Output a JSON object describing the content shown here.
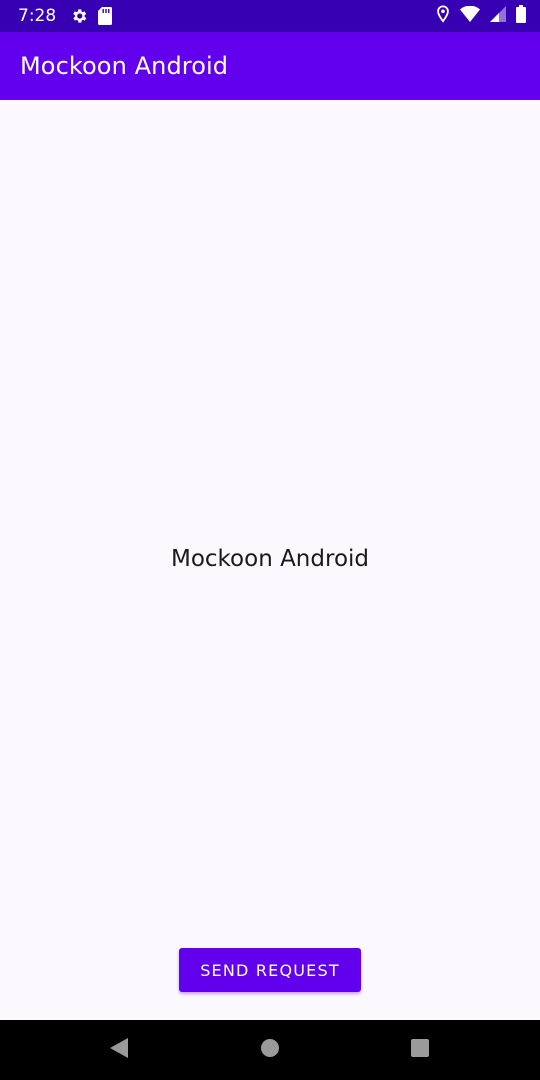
{
  "status_bar": {
    "time": "7:28",
    "left_icons": [
      "gear-icon",
      "sd-card-icon"
    ],
    "right_icons": [
      "location-icon",
      "wifi-icon",
      "cellular-signal-icon",
      "battery-icon"
    ]
  },
  "app_bar": {
    "title": "Mockoon Android"
  },
  "main": {
    "center_text": "Mockoon Android",
    "send_button_label": "SEND REQUEST"
  },
  "nav_bar": {
    "buttons": [
      "back-icon",
      "home-icon",
      "recents-icon"
    ]
  },
  "colors": {
    "status_bar": "#3700b3",
    "primary": "#6200ee",
    "background": "#fbf9fd",
    "nav_bar": "#000000"
  }
}
